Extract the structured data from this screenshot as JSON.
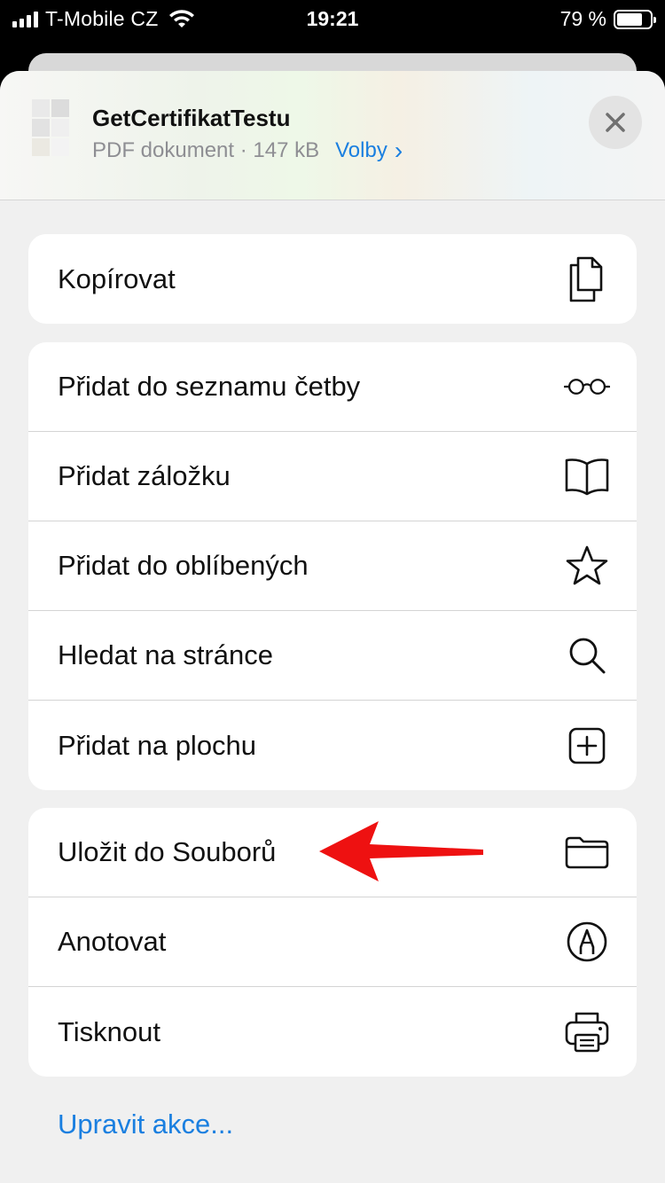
{
  "status_bar": {
    "carrier": "T-Mobile CZ",
    "time": "19:21",
    "battery_percent": "79 %",
    "battery_level": 0.79
  },
  "header": {
    "title": "GetCertifikatTestu",
    "meta": "PDF dokument · 147 kB",
    "options_label": "Volby",
    "options_chevron": "›"
  },
  "groups": [
    {
      "items": [
        {
          "label": "Kopírovat",
          "icon": "copy-icon"
        }
      ]
    },
    {
      "items": [
        {
          "label": "Přidat do seznamu četby",
          "icon": "glasses-icon"
        },
        {
          "label": "Přidat záložku",
          "icon": "book-icon"
        },
        {
          "label": "Přidat do oblíbených",
          "icon": "star-icon"
        },
        {
          "label": "Hledat na stránce",
          "icon": "search-icon"
        },
        {
          "label": "Přidat na plochu",
          "icon": "add-square-icon"
        }
      ]
    },
    {
      "items": [
        {
          "label": "Uložit do Souborů",
          "icon": "folder-icon"
        },
        {
          "label": "Anotovat",
          "icon": "markup-icon"
        },
        {
          "label": "Tisknout",
          "icon": "printer-icon"
        }
      ]
    }
  ],
  "footer": {
    "edit_actions": "Upravit akce..."
  },
  "colors": {
    "accent": "#1a7fe0",
    "annotation_arrow": "#ee1111"
  }
}
